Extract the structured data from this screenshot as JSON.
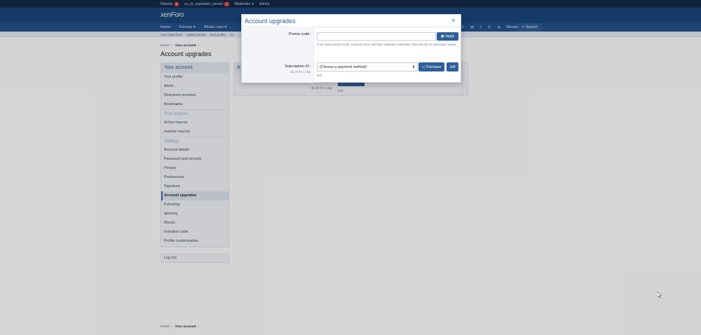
{
  "staffbar": {
    "items": [
      {
        "label": "Reports",
        "badge": "1"
      },
      {
        "label": "xs_cs_expiration_vendor",
        "badge": "1"
      },
      {
        "label": "Moderator",
        "caret": "▾"
      },
      {
        "label": "Admin"
      }
    ]
  },
  "header": {
    "logo": "xenForo"
  },
  "nav": {
    "tabs": [
      {
        "label": "Home"
      },
      {
        "label": "Forums",
        "caret": "▾"
      },
      {
        "label": "What's new",
        "caret": "▾"
      }
    ],
    "moods_label": "Moods",
    "search_label": "Search"
  },
  "subnav": {
    "links": [
      "Your news feed",
      "Latest activity",
      "Your profile",
      "Yo"
    ]
  },
  "breadcrumb": {
    "home": "Home",
    "account": "Your account",
    "sep": "›"
  },
  "page_title": "Account upgrades",
  "sidebar": {
    "title": "Your account",
    "sections": [
      {
        "items": [
          "Your profile",
          "Alerts",
          "Reactions received",
          "Bookmarks"
        ]
      },
      {
        "group": "Post macros",
        "items": [
          "Active macros",
          "Inactive macros"
        ]
      },
      {
        "group": "Settings",
        "items": [
          "Account details",
          "Password and security",
          "Privacy",
          "Preferences",
          "Signature",
          "Account upgrades",
          "Following",
          "Ignoring",
          "Moods",
          "Invitation code",
          "Profile customization"
        ]
      }
    ],
    "active": "Account upgrades",
    "logout": "Log out"
  },
  "main_panel": {
    "heading": "A",
    "cost_line1": "…",
    "cost_line2": "$1.00 for 1 day",
    "subnote": "test"
  },
  "modal": {
    "title": "Account upgrades",
    "close_icon": "×",
    "promo_label": "Promo code:",
    "promo_value": "",
    "apply_label": "Apply",
    "promo_hint": "If you had a promo code, entered it here and then validated, otherwise click directly on \"purchase\" below.",
    "subscription_label": "Subcription #1:",
    "subscription_cost": "$1.00 for 1 day",
    "payment_select": "(Choose a payment method)",
    "purchase_label": "Purchase",
    "gift_label": "Gift",
    "subscription_note": "test"
  }
}
